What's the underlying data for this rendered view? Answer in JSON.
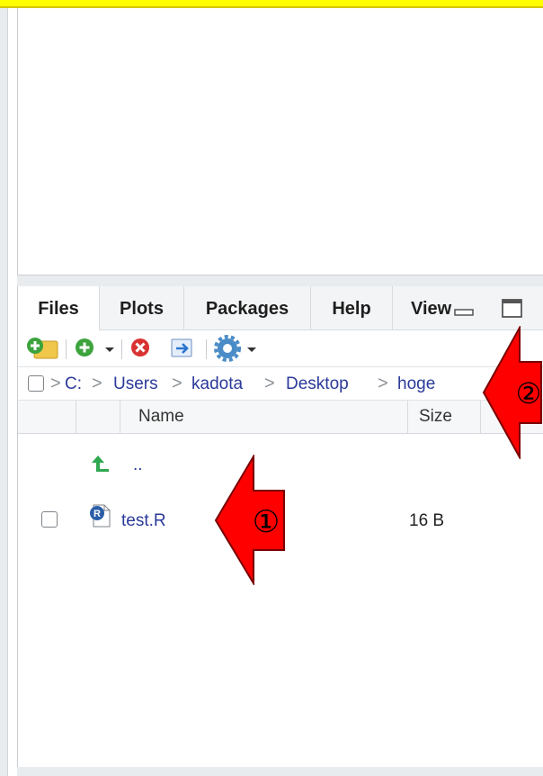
{
  "tabs": [
    {
      "label": "Files",
      "active": true
    },
    {
      "label": "Plots",
      "active": false
    },
    {
      "label": "Packages",
      "active": false
    },
    {
      "label": "Help",
      "active": false
    },
    {
      "label": "View",
      "active": false
    }
  ],
  "breadcrumb": [
    "C:",
    "Users",
    "kadota",
    "Desktop",
    "hoge"
  ],
  "columns": {
    "name": "Name",
    "size": "Size"
  },
  "files": {
    "parent": "..",
    "items": [
      {
        "name": "test.R",
        "size": "16 B",
        "icon": "r-file-icon"
      }
    ]
  },
  "annotations": {
    "one": "①",
    "two": "②",
    "color": "#ff0000"
  },
  "colors": {
    "title_strip": "#ffff00",
    "link": "#2b3a9a"
  }
}
